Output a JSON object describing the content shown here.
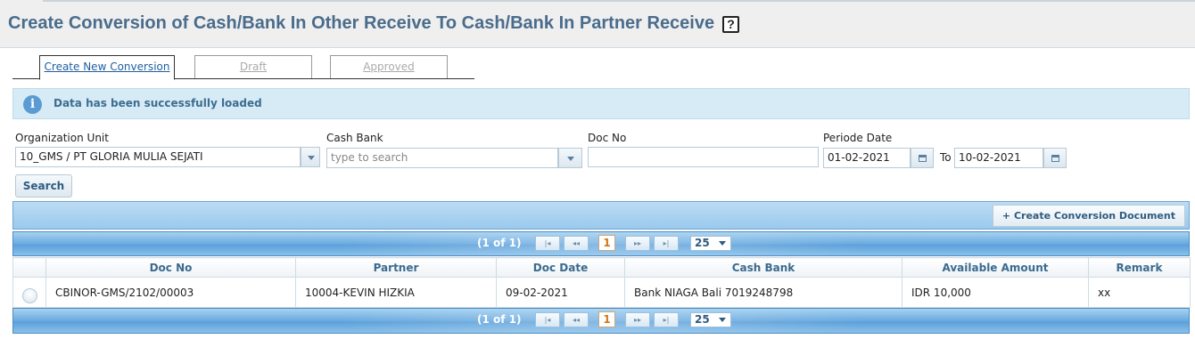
{
  "page": {
    "title": "Create Conversion of Cash/Bank In Other Receive To Cash/Bank In Partner Receive",
    "help_symbol": "?"
  },
  "tabs": [
    {
      "label": "Create New Conversion",
      "active": true
    },
    {
      "label": "Draft",
      "active": false
    },
    {
      "label": "Approved",
      "active": false
    }
  ],
  "alert": {
    "icon": "info-icon",
    "icon_glyph": "i",
    "message": "Data has been successfully loaded"
  },
  "filters": {
    "org_unit": {
      "label": "Organization Unit",
      "value": "10_GMS / PT GLORIA MULIA SEJATI"
    },
    "cash_bank": {
      "label": "Cash Bank",
      "value": "",
      "placeholder": "type to search"
    },
    "doc_no": {
      "label": "Doc No",
      "value": ""
    },
    "period": {
      "label": "Periode Date",
      "from": "01-02-2021",
      "to_label": "To",
      "to": "10-02-2021"
    },
    "search_label": "Search"
  },
  "toolbar": {
    "create_doc_symbol": "+",
    "create_doc_label": "Create Conversion Document"
  },
  "pager": {
    "count": "(1 of 1)",
    "first": "|◂",
    "prev": "◂◂",
    "page": "1",
    "next": "▸▸",
    "last": "▸|",
    "rows_per_page": "25"
  },
  "grid": {
    "columns": [
      "",
      "Doc No",
      "Partner",
      "Doc Date",
      "Cash Bank",
      "Available Amount",
      "Remark"
    ],
    "rows": [
      {
        "doc_no": "CBINOR-GMS/2102/00003",
        "partner": "10004-KEVIN HIZKIA",
        "doc_date": "09-02-2021",
        "cash_bank": "Bank NIAGA Bali 7019248798",
        "available_amount": "IDR 10,000",
        "remark": "xx"
      }
    ]
  },
  "colors": {
    "title": "#4a6c8c",
    "grid_bar": "#5a9fd6",
    "alert_bg": "#d6ebf6",
    "page_num": "#d0781a"
  }
}
